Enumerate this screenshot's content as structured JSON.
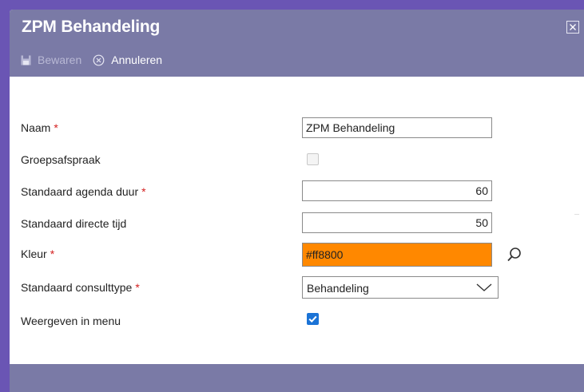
{
  "dialog": {
    "title": "ZPM Behandeling",
    "close_icon": "close-icon",
    "toolbar": {
      "save_label": "Bewaren",
      "save_icon": "floppy-disk-icon",
      "cancel_label": "Annuleren",
      "cancel_icon": "cancel-circle-icon"
    }
  },
  "form": {
    "required_marker": "*",
    "naam": {
      "label": "Naam",
      "value": "ZPM Behandeling",
      "required": true
    },
    "groepsafspraak": {
      "label": "Groepsafspraak",
      "checked": false,
      "disabled": true
    },
    "agenda_duur": {
      "label": "Standaard agenda duur",
      "value": "60",
      "required": true
    },
    "directe_tijd": {
      "label": "Standaard directe tijd",
      "value": "50",
      "required": false
    },
    "kleur": {
      "label": "Kleur",
      "value": "#ff8800",
      "required": true,
      "search_icon": "magnifier-icon"
    },
    "consulttype": {
      "label": "Standaard consulttype",
      "value": "Behandeling",
      "required": true,
      "dropdown_icon": "chevron-down-icon"
    },
    "weergeven": {
      "label": "Weergeven in menu",
      "checked": true
    }
  },
  "colors": {
    "header_bg": "#7a7aa6",
    "backdrop": "#6a55b4",
    "required": "#d42020",
    "checkbox_on": "#1b73d6",
    "color_swatch": "#ff8800"
  }
}
